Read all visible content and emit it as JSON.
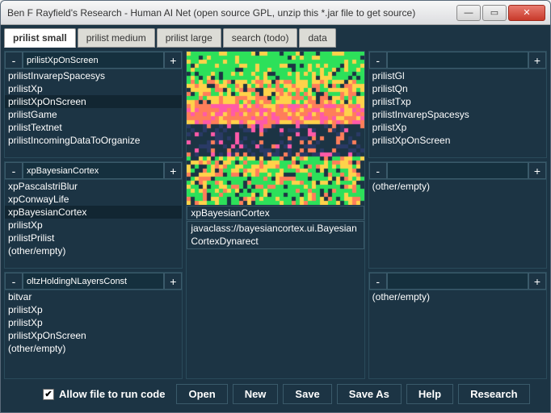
{
  "window": {
    "title": "Ben F Rayfield's Research - Human AI Net (open source GPL, unzip this *.jar file to get source)",
    "min": "—",
    "max": "▭",
    "close": "✕"
  },
  "tabs": [
    {
      "label": "prilist small",
      "active": true
    },
    {
      "label": "prilist medium",
      "active": false
    },
    {
      "label": "prilist large",
      "active": false
    },
    {
      "label": "search (todo)",
      "active": false
    },
    {
      "label": "data",
      "active": false
    }
  ],
  "panels": {
    "p00": {
      "input": "prilistXpOnScreen",
      "items": [
        "prilistInvarepSpacesys",
        "prilistXp",
        "prilistXpOnScreen",
        "prilistGame",
        "prilistTextnet",
        "prilistIncomingDataToOrganize"
      ],
      "selected": 2
    },
    "p10": {
      "input": "xpBayesianCortex",
      "items": [
        "xpPascalstriBlur",
        "xpConwayLife",
        "xpBayesianCortex",
        "prilistXp",
        "prilistPrilist",
        "(other/empty)"
      ],
      "selected": 2
    },
    "p20": {
      "input": "oltzHoldingNLayersConst",
      "items": [
        "bitvar",
        "prilistXp",
        "prilistXp",
        "prilistXpOnScreen",
        "(other/empty)"
      ],
      "selected": -1
    },
    "p02": {
      "input": "",
      "items": [
        "prilistGl",
        "prilistQn",
        "prilistTxp",
        "prilistInvarepSpacesys",
        "prilistXp",
        "prilistXpOnScreen"
      ],
      "selected": -1
    },
    "p12": {
      "input": "",
      "items": [
        "(other/empty)"
      ],
      "selected": -1
    },
    "p22": {
      "input": "",
      "items": [
        "(other/empty)"
      ],
      "selected": -1
    }
  },
  "center": {
    "name": "xpBayesianCortex",
    "class": "javaclass://bayesiancortex.ui.BayesianCortexDynarect"
  },
  "bottom": {
    "checkbox_label": "Allow file to run code",
    "checked": true,
    "buttons": [
      "Open",
      "New",
      "Save",
      "Save As",
      "Help",
      "Research"
    ]
  },
  "glyphs": {
    "minus": "-",
    "plus": "+",
    "check": "✔"
  }
}
